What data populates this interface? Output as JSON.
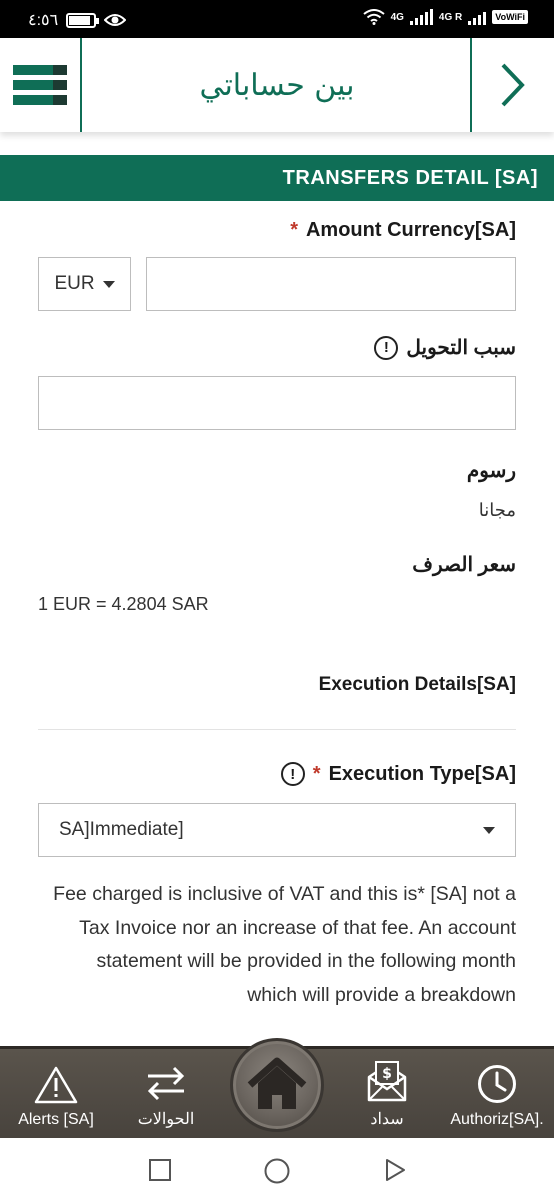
{
  "status_bar": {
    "time": "٤:٥٦",
    "network_1": "4G",
    "network_2": "4G R",
    "volte": "VoWiFi"
  },
  "header": {
    "title": "بين حساباتي"
  },
  "section": {
    "title": "TRANSFERS DETAIL [SA]"
  },
  "form": {
    "amount_currency_label": "Amount Currency[SA]",
    "required_mark": "*",
    "currency_value": "EUR",
    "amount_value": "",
    "transfer_reason_label": "سبب التحويل",
    "transfer_reason_value": "",
    "info_glyph": "!",
    "fees_label": "رسوم",
    "fees_value": "مجانا",
    "exchange_rate_label": "سعر الصرف",
    "exchange_rate_value": "1 EUR = 4.2804 SAR",
    "execution_details_label": "Execution Details[SA]",
    "execution_type_label": "Execution Type[SA]",
    "execution_type_value": "SA]Immediate]",
    "note_text": "Fee charged is inclusive of VAT and this is* [SA] not a Tax Invoice nor an increase of that fee. An account statement will be provided in the following month which will provide a breakdown"
  },
  "bottom_nav": {
    "items": [
      {
        "label": "Alerts [SA]",
        "icon": "warning-icon"
      },
      {
        "label": "الحوالات",
        "icon": "transfer-arrows-icon"
      },
      {
        "label": "",
        "icon": "home-icon"
      },
      {
        "label": "سداد",
        "icon": "bill-envelope-icon"
      },
      {
        "label": "Authoriz[SA].",
        "icon": "clock-icon"
      }
    ]
  },
  "colors": {
    "brand": "#0f6e56",
    "required": "#c0392b",
    "nav_bg": "#4f4a44"
  }
}
